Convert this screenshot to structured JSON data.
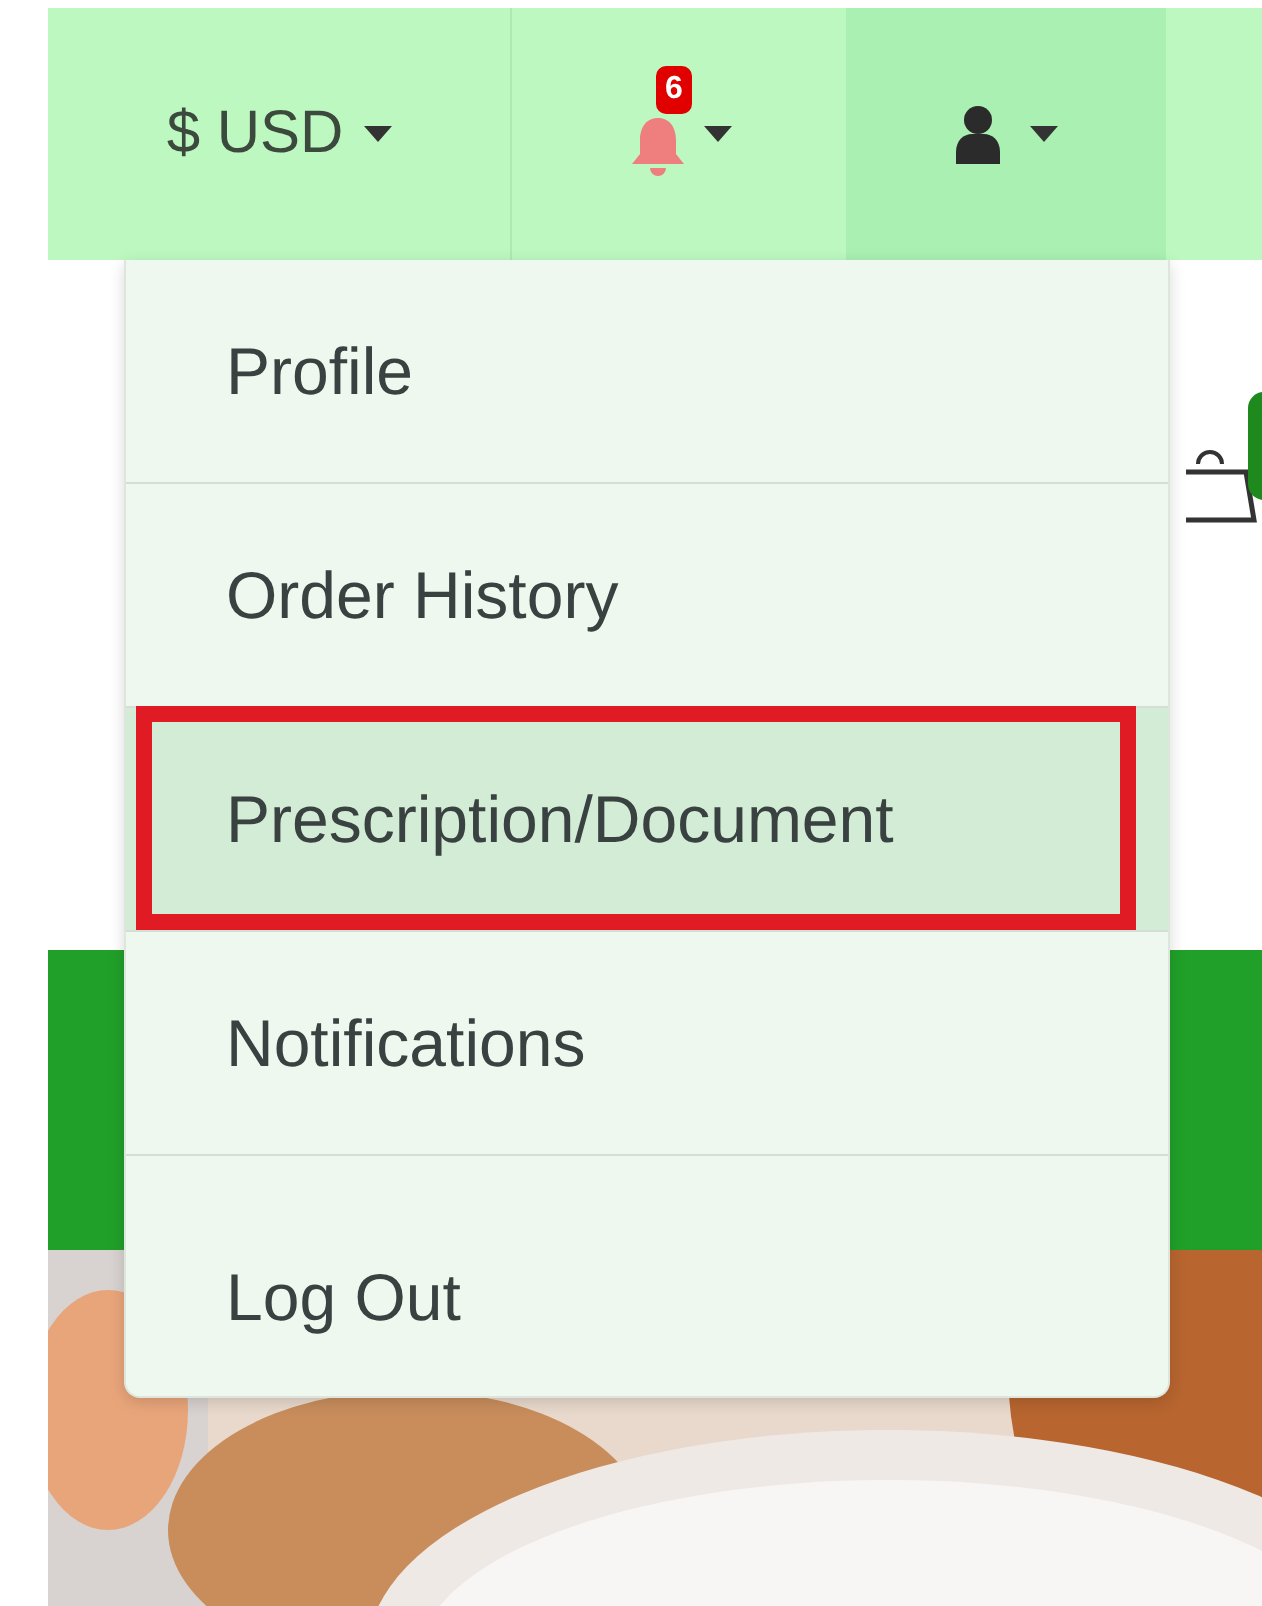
{
  "top_bar": {
    "currency": {
      "label": "$ USD"
    },
    "notifications": {
      "badge": "6"
    },
    "account": {
      "expanded": true
    }
  },
  "account_menu": {
    "items": [
      {
        "label": "Profile",
        "selected": false,
        "outlined": false
      },
      {
        "label": "Order History",
        "selected": false,
        "outlined": false
      },
      {
        "label": "Prescription/Document",
        "selected": true,
        "outlined": true
      },
      {
        "label": "Notifications",
        "selected": false,
        "outlined": false
      },
      {
        "label": "Log Out",
        "selected": false,
        "outlined": false
      }
    ]
  }
}
